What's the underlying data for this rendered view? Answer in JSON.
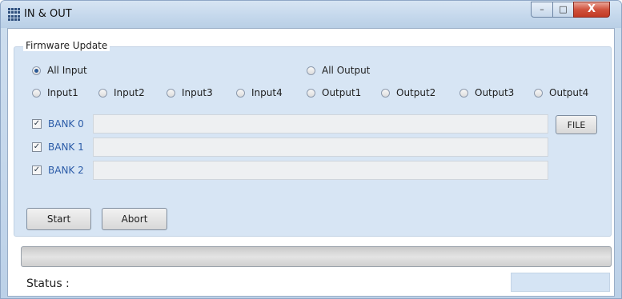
{
  "window": {
    "title": "IN & OUT",
    "minimize_glyph": "–",
    "maximize_glyph": "□",
    "close_glyph": "X",
    "app_icon": "grid-app-icon"
  },
  "group": {
    "label": "Firmware Update",
    "all_input": "All Input",
    "all_output": "All Output",
    "selected": "All Input",
    "inputs": [
      "Input1",
      "Input2",
      "Input3",
      "Input4"
    ],
    "outputs": [
      "Output1",
      "Output2",
      "Output3",
      "Output4"
    ]
  },
  "banks": [
    {
      "label": "BANK 0",
      "checked": true,
      "path": ""
    },
    {
      "label": "BANK 1",
      "checked": true,
      "path": ""
    },
    {
      "label": "BANK 2",
      "checked": true,
      "path": ""
    }
  ],
  "check_glyph": "✓",
  "buttons": {
    "file": "FILE",
    "start": "Start",
    "abort": "Abort"
  },
  "progress": {
    "value": 0
  },
  "status": {
    "label": "Status :",
    "value": ""
  },
  "colors": {
    "accent": "#2c5ca8",
    "group_bg": "#d7e5f4",
    "status_box": "#d5e4f4"
  }
}
